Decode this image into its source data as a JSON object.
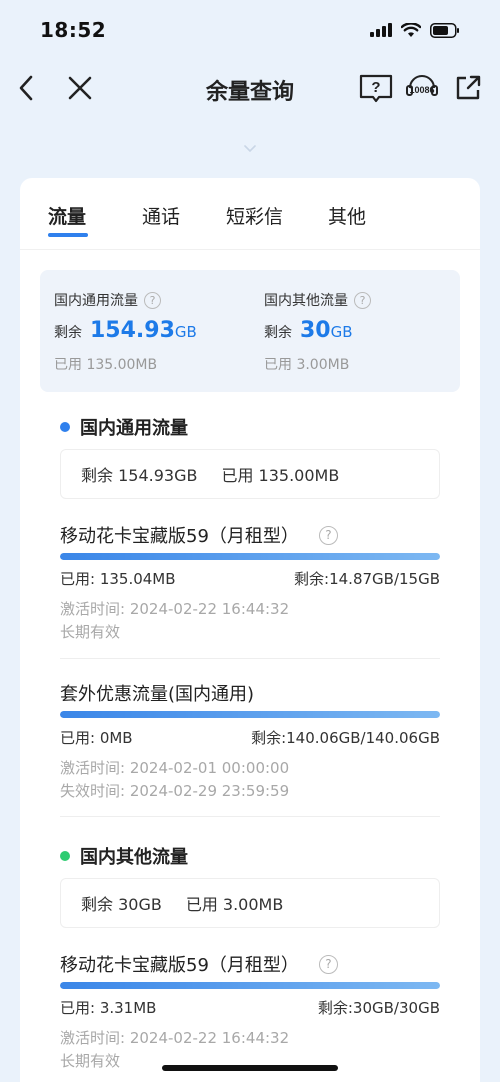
{
  "status_bar": {
    "time": "18:52"
  },
  "nav": {
    "title": "余量查询",
    "service_number": "10086"
  },
  "tabs": [
    {
      "label": "流量"
    },
    {
      "label": "通话"
    },
    {
      "label": "短彩信"
    },
    {
      "label": "其他"
    }
  ],
  "summary": {
    "domestic_general": {
      "title": "国内通用流量",
      "remain_label": "剩余",
      "remain_value": "154.93",
      "remain_unit": "GB",
      "used": "已用  135.00MB"
    },
    "domestic_other": {
      "title": "国内其他流量",
      "remain_label": "剩余",
      "remain_value": "30",
      "remain_unit": "GB",
      "used": "已用  3.00MB"
    }
  },
  "section_general": {
    "title": "国内通用流量",
    "dot_color": "#2f80ed",
    "remain": "剩余 154.93GB",
    "used": "已用 135.00MB",
    "items": [
      {
        "name": "移动花卡宝藏版59（月租型）",
        "used": "已用: 135.04MB",
        "remain": "剩余:14.87GB/15GB",
        "progress_fraction": 1.0,
        "meta1": "激活时间: 2024-02-22 16:44:32",
        "meta2": "长期有效"
      },
      {
        "name": "套外优惠流量(国内通用)",
        "used": "已用: 0MB",
        "remain": "剩余:140.06GB/140.06GB",
        "progress_fraction": 1.0,
        "meta1": "激活时间: 2024-02-01 00:00:00",
        "meta2": "失效时间: 2024-02-29 23:59:59"
      }
    ]
  },
  "section_other": {
    "title": "国内其他流量",
    "dot_color": "#2ecc71",
    "remain": "剩余 30GB",
    "used": "已用 3.00MB",
    "items": [
      {
        "name": "移动花卡宝藏版59（月租型）",
        "used": "已用: 3.31MB",
        "remain": "剩余:30GB/30GB",
        "progress_fraction": 1.0,
        "meta1": "激活时间: 2024-02-22 16:44:32",
        "meta2": "长期有效"
      }
    ]
  },
  "colors": {
    "accent": "#1d7ae8",
    "page_bg": "#eaf2fb",
    "tab_underline": "#2f80ed"
  }
}
